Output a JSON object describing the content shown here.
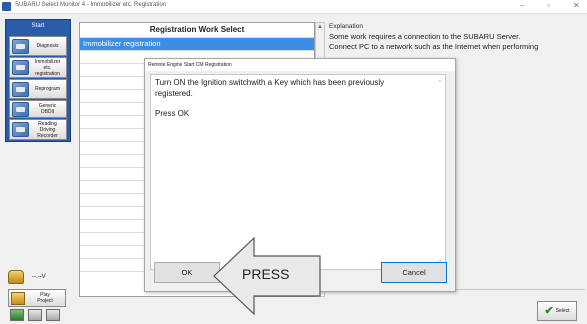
{
  "window": {
    "title": "SUBARU Select Monitor 4 - Immobilizer etc. Registration",
    "minimize_glyph": "–",
    "restore_glyph": "▫",
    "close_glyph": "✕"
  },
  "sidebar": {
    "start_label": "Start",
    "nav": [
      {
        "label": "Diagnosis",
        "icon": "diagnosis-icon"
      },
      {
        "label": "Immobilizer\netc.\nregistration",
        "icon": "immobilizer-icon"
      },
      {
        "label": "Reprogram",
        "icon": "reprogram-icon"
      },
      {
        "label": "Generic\nOBDII",
        "icon": "obd-icon"
      },
      {
        "label": "Reading\nDriving\nRecorder",
        "icon": "recorder-icon"
      }
    ],
    "version": "--.--V",
    "play_project": "Play\nProject"
  },
  "work_select": {
    "header": "Registration Work Select",
    "rows": [
      "Immobilizer registration",
      "",
      "",
      "",
      "",
      "",
      "",
      "",
      "",
      "",
      "",
      "",
      "",
      "",
      "",
      "",
      "",
      "",
      ""
    ]
  },
  "explanation": {
    "header": "Explanation",
    "lines": [
      "Some work requires a connection to the SUBARU Server.",
      "Connect PC to a network such as the Internet when performing"
    ]
  },
  "dialog": {
    "title": "Remote Engine Start CM Registration",
    "message_line1": "Turn ON the Ignition switchwith a Key which has been previously",
    "message_line2": "registered.",
    "message_line3": "Press OK",
    "ok_label": "OK",
    "cancel_label": "Cancel"
  },
  "callout": {
    "text": "PRESS"
  },
  "select_button": {
    "label": "Select"
  },
  "colors": {
    "nav_blue": "#2a5caa",
    "selection": "#3a8ee6",
    "cancel_focus": "#0078d7"
  }
}
